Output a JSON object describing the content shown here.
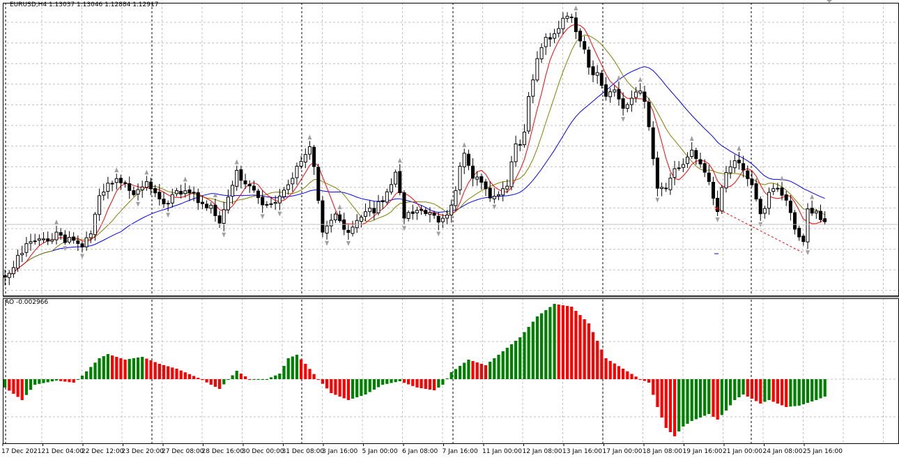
{
  "header": {
    "symbol": "EURUSD,H4",
    "ohlc": "1.13037 1.13046 1.12884 1.12917",
    "label": "EURUSD,H4  1.13037 1.13046 1.12884 1.12917"
  },
  "indicator": {
    "label": "AO -0.002966",
    "name": "AO",
    "current_value": -0.002966
  },
  "colors": {
    "background": "#ffffff",
    "frame": "#000000",
    "grid": "#c0c0c0",
    "bull_candle": "#ffffff",
    "bear_candle": "#000000",
    "ma_fast": "#ff0000",
    "ma_mid": "#808000",
    "ma_slow": "#0000ff",
    "ao_up": "#008000",
    "ao_down": "#ff0000",
    "fractal": "#a0a0a0",
    "trend_line": "#ff0000"
  },
  "chart_data": [
    {
      "type": "candlestick",
      "symbol": "EURUSD",
      "timeframe": "H4",
      "x_tick_labels": [
        "17 Dec 2021",
        "21 Dec 04:00",
        "22 Dec 12:00",
        "23 Dec 20:00",
        "27 Dec 08:00",
        "28 Dec 16:00",
        "30 Dec 00:00",
        "31 Dec 08:00",
        "3 Jan 16:00",
        "5 Jan 00:00",
        "6 Jan 08:00",
        "7 Jan 16:00",
        "11 Jan 00:00",
        "12 Jan 08:00",
        "13 Jan 16:00",
        "17 Jan 00:00",
        "18 Jan 08:00",
        "19 Jan 16:00",
        "21 Jan 00:00",
        "24 Jan 08:00",
        "25 Jan 16:00"
      ],
      "overlays": [
        "fast moving average (red)",
        "medium moving average (olive)",
        "slow moving average (blue)",
        "fractal arrows",
        "dashed trend line"
      ],
      "grid": true,
      "y_tick_labels_shown": false
    },
    {
      "type": "bar",
      "name": "AO",
      "current_value": -0.002966,
      "grid": true,
      "zero_line": true
    }
  ]
}
